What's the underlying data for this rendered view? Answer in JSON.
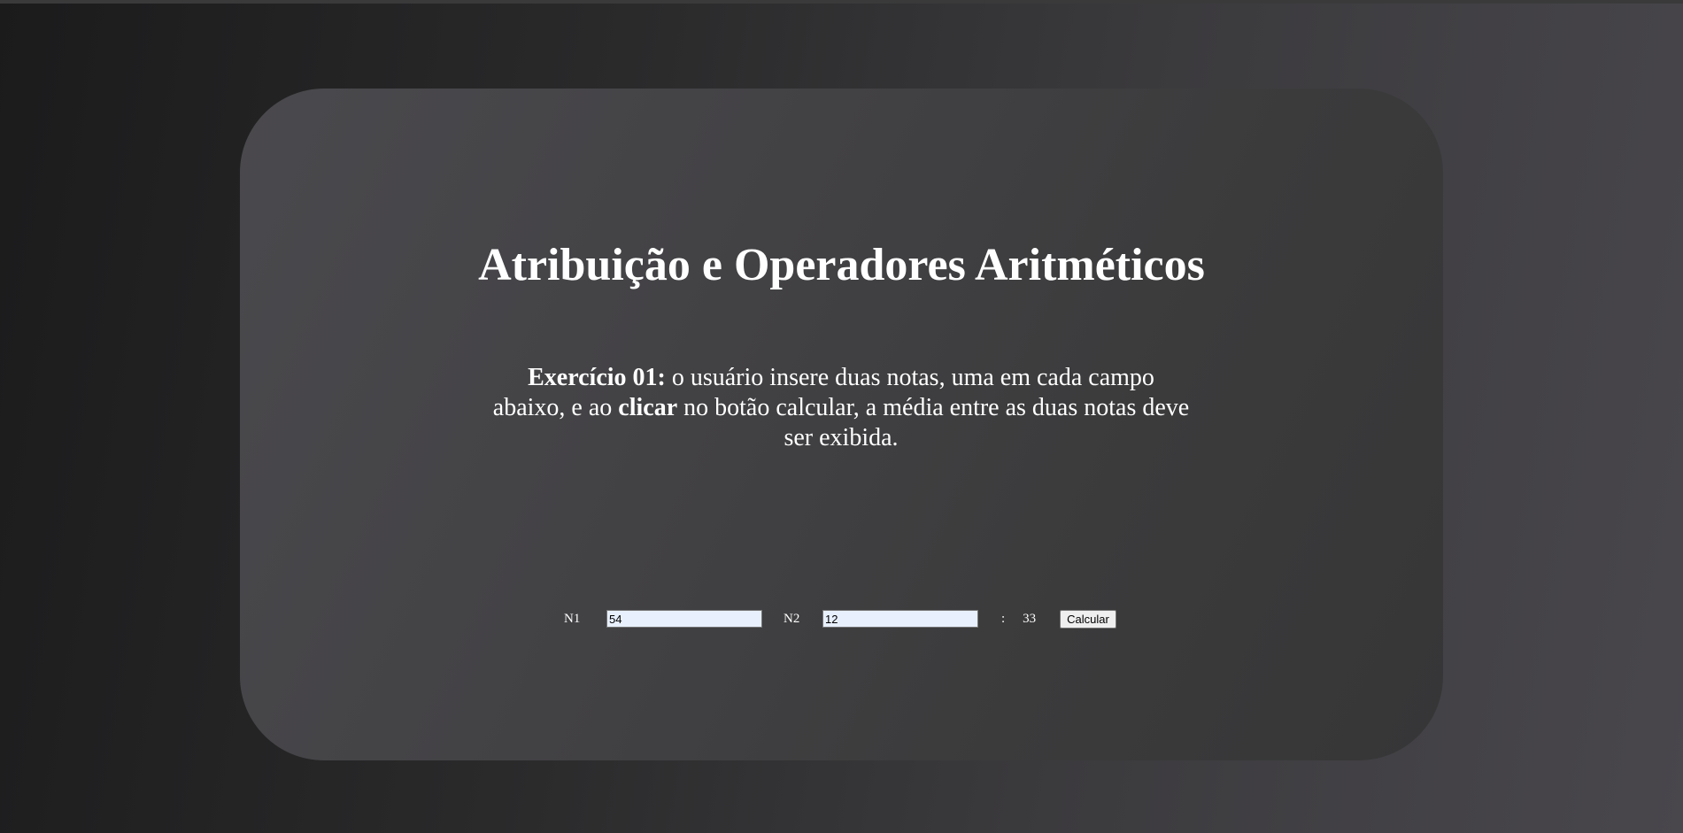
{
  "page": {
    "title": "Atribuição e Operadores Aritméticos"
  },
  "exercise": {
    "label": "Exercício 01:",
    "text_part1": " o usuário insere duas notas, uma em cada campo abaixo, e ao ",
    "emphasis": "clicar",
    "text_part2": " no botão calcular, a média entre as duas notas deve ser exibida."
  },
  "form": {
    "n1_label": "N1",
    "n1_value": "54",
    "n2_label": "N2",
    "n2_value": "12",
    "separator": ":",
    "result": "33",
    "button_label": "Calcular"
  },
  "colors": {
    "background_dark": "#1b1b1c",
    "background_light": "#49474c",
    "card": "#424145",
    "text": "#ffffff",
    "input_background": "#e8f0fe"
  }
}
